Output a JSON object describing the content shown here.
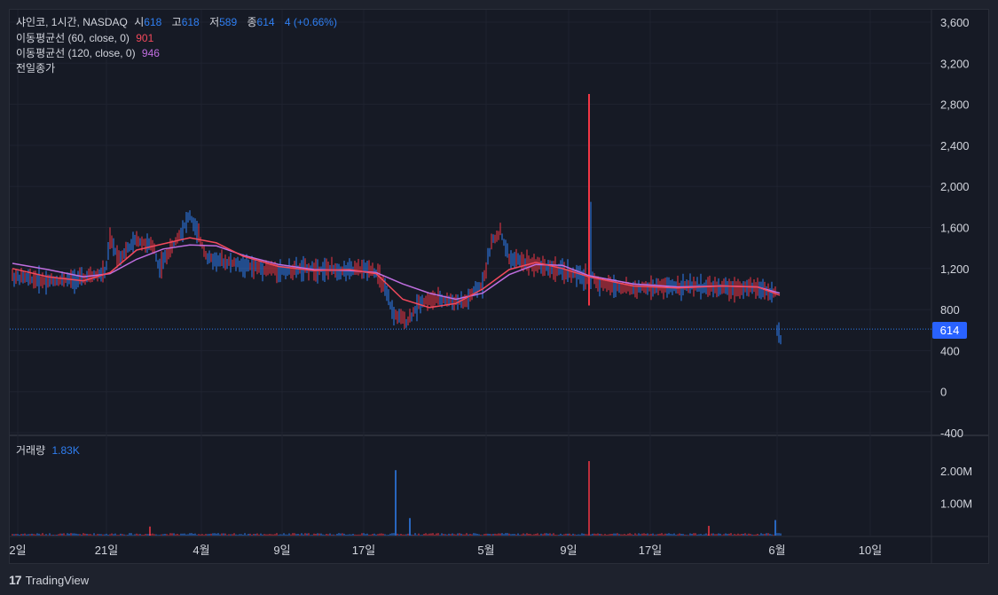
{
  "legend": {
    "symbol": "샤인코, 1시간, NASDAQ",
    "open_label": "시",
    "open": "618",
    "high_label": "고",
    "high": "618",
    "low_label": "저",
    "low": "589",
    "close_label": "종",
    "close": "614",
    "change": "4 (+0.66%)",
    "ma60_label": "이동평균선 (60, close, 0)",
    "ma60_value": "901",
    "ma120_label": "이동평균선 (120, close, 0)",
    "ma120_value": "946",
    "prev_close_label": "전일종가",
    "volume_label": "거래량",
    "volume_value": "1.83K"
  },
  "price_tag": "614",
  "brand": {
    "logo_text": "17",
    "name": "TradingView"
  },
  "colors": {
    "up": "#2f7ff2",
    "down": "#f23645",
    "ma60": "#f2495c",
    "ma120": "#c06ee0",
    "background": "#161a25"
  },
  "chart_data": {
    "type": "candlestick",
    "price_axis": {
      "ticks": [
        3600,
        3200,
        2800,
        2400,
        2000,
        1600,
        1200,
        800,
        400,
        0,
        -400
      ],
      "ylim": [
        -400,
        3600
      ]
    },
    "volume_axis": {
      "ticks": [
        "2.00M",
        "1.00M"
      ],
      "tick_values": [
        2000000,
        1000000
      ]
    },
    "x_ticks": [
      "2일",
      "21일",
      "4월",
      "9일",
      "17일",
      "5월",
      "9일",
      "17일",
      "6월",
      "10일"
    ],
    "last_price": 614,
    "prev_close": 610,
    "ma60_points": [
      [
        0,
        1200
      ],
      [
        40,
        1120
      ],
      [
        80,
        1080
      ],
      [
        110,
        1160
      ],
      [
        140,
        1380
      ],
      [
        170,
        1440
      ],
      [
        200,
        1500
      ],
      [
        230,
        1450
      ],
      [
        260,
        1320
      ],
      [
        300,
        1220
      ],
      [
        340,
        1180
      ],
      [
        380,
        1190
      ],
      [
        410,
        1150
      ],
      [
        440,
        900
      ],
      [
        470,
        820
      ],
      [
        500,
        860
      ],
      [
        530,
        1000
      ],
      [
        560,
        1190
      ],
      [
        590,
        1260
      ],
      [
        620,
        1200
      ],
      [
        650,
        1120
      ],
      [
        700,
        1030
      ],
      [
        750,
        1010
      ],
      [
        800,
        1030
      ],
      [
        840,
        1020
      ],
      [
        865,
        940
      ]
    ],
    "ma120_points": [
      [
        0,
        1250
      ],
      [
        40,
        1190
      ],
      [
        80,
        1120
      ],
      [
        110,
        1150
      ],
      [
        140,
        1290
      ],
      [
        170,
        1390
      ],
      [
        200,
        1430
      ],
      [
        230,
        1420
      ],
      [
        260,
        1330
      ],
      [
        300,
        1240
      ],
      [
        340,
        1190
      ],
      [
        380,
        1180
      ],
      [
        410,
        1160
      ],
      [
        440,
        1050
      ],
      [
        470,
        960
      ],
      [
        500,
        900
      ],
      [
        530,
        960
      ],
      [
        560,
        1140
      ],
      [
        590,
        1240
      ],
      [
        620,
        1230
      ],
      [
        650,
        1130
      ],
      [
        700,
        1050
      ],
      [
        750,
        1020
      ],
      [
        800,
        1030
      ],
      [
        840,
        1020
      ],
      [
        865,
        960
      ]
    ],
    "candle_profile": [
      [
        0,
        1120
      ],
      [
        40,
        1080
      ],
      [
        80,
        1100
      ],
      [
        105,
        1160
      ],
      [
        110,
        1480
      ],
      [
        120,
        1300
      ],
      [
        140,
        1480
      ],
      [
        160,
        1400
      ],
      [
        165,
        1200
      ],
      [
        185,
        1480
      ],
      [
        200,
        1720
      ],
      [
        220,
        1300
      ],
      [
        260,
        1230
      ],
      [
        300,
        1180
      ],
      [
        340,
        1200
      ],
      [
        380,
        1180
      ],
      [
        405,
        1200
      ],
      [
        415,
        1100
      ],
      [
        430,
        750
      ],
      [
        445,
        680
      ],
      [
        460,
        880
      ],
      [
        480,
        900
      ],
      [
        510,
        870
      ],
      [
        530,
        1050
      ],
      [
        540,
        1450
      ],
      [
        550,
        1560
      ],
      [
        560,
        1300
      ],
      [
        600,
        1220
      ],
      [
        630,
        1150
      ],
      [
        650,
        1100
      ],
      [
        652,
        1150
      ],
      [
        660,
        1050
      ],
      [
        700,
        1000
      ],
      [
        750,
        1030
      ],
      [
        800,
        1010
      ],
      [
        840,
        1010
      ],
      [
        860,
        960
      ],
      [
        862,
        600
      ],
      [
        866,
        520
      ],
      [
        870,
        640
      ]
    ],
    "spike": {
      "x": 650,
      "high": 2900,
      "low": 840
    },
    "volume_spikes": [
      [
        432,
        2020000
      ],
      [
        448,
        540000
      ],
      [
        650,
        2300000
      ],
      [
        860,
        480000
      ],
      [
        155,
        280000
      ],
      [
        785,
        300000
      ]
    ]
  }
}
